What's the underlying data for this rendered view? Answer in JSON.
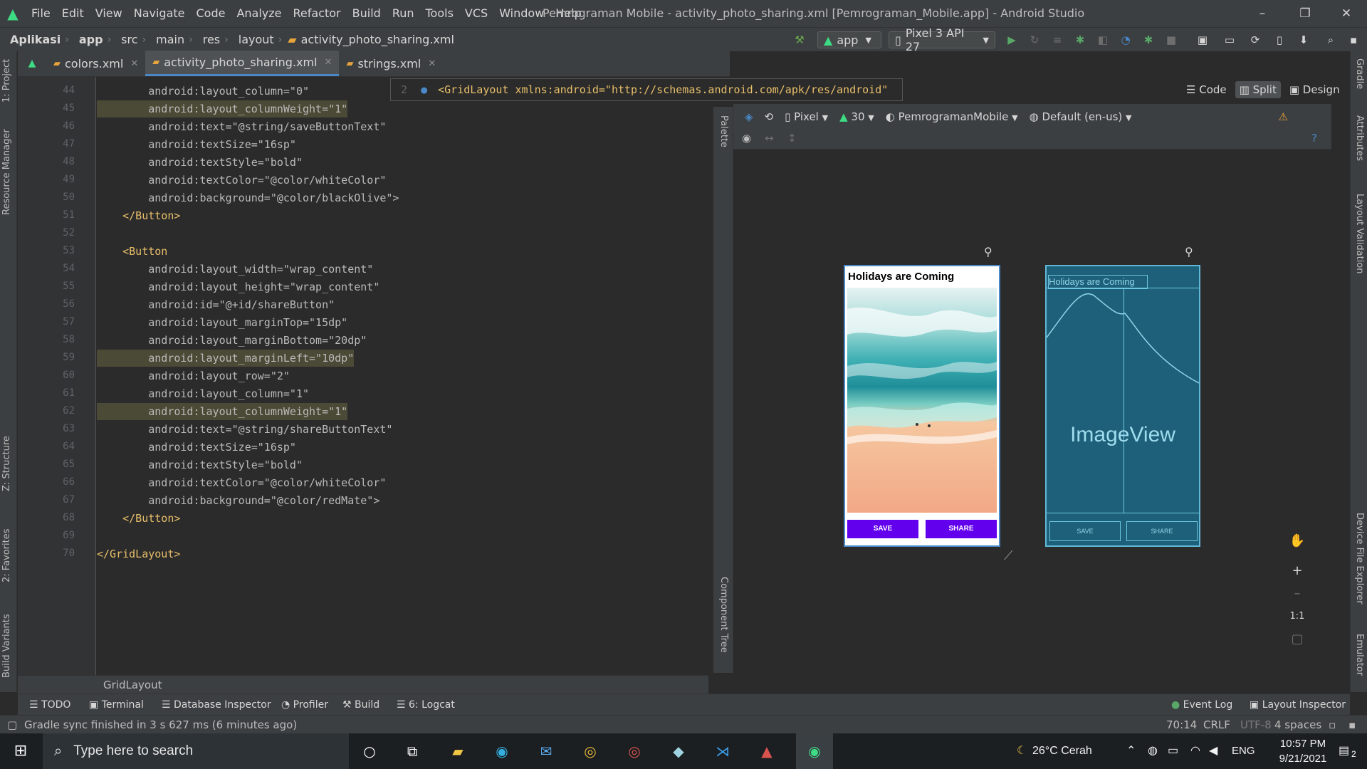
{
  "window": {
    "title": "Pemrograman Mobile - activity_photo_sharing.xml [Pemrograman_Mobile.app] - Android Studio",
    "controls": {
      "minimize": "–",
      "maximize": "❐",
      "close": "✕"
    }
  },
  "menu": [
    "File",
    "Edit",
    "View",
    "Navigate",
    "Code",
    "Analyze",
    "Refactor",
    "Build",
    "Run",
    "Tools",
    "VCS",
    "Window",
    "Help"
  ],
  "breadcrumb": [
    "Aplikasi",
    "app",
    "src",
    "main",
    "res",
    "layout",
    "activity_photo_sharing.xml"
  ],
  "toolbar": {
    "run_config": "app",
    "device": "Pixel 3 API 27"
  },
  "tabs": [
    {
      "label": "colors.xml"
    },
    {
      "label": "activity_photo_sharing.xml"
    },
    {
      "label": "strings.xml"
    }
  ],
  "left_strip": {
    "project": "1: Project",
    "resource_manager": "Resource Manager",
    "structure": "Z: Structure",
    "favorites": "2: Favorites",
    "build_variants": "Build Variants"
  },
  "right_strip": {
    "gradle": "Gradle",
    "attributes": "Attributes",
    "layout_validation": "Layout Validation",
    "device_file_explorer": "Device File Explorer",
    "emulator": "Emulator"
  },
  "breadcrumb_popup": {
    "line": "2",
    "code": "<GridLayout xmlns:android=\"http://schemas.android.com/apk/res/android\""
  },
  "editor": {
    "lines": [
      {
        "n": "44",
        "text": "        android:layout_column=\"0\""
      },
      {
        "n": "45",
        "text": "        android:layout_columnWeight=\"1\""
      },
      {
        "n": "46",
        "text": "        android:text=\"@string/saveButtonText\""
      },
      {
        "n": "47",
        "text": "        android:textSize=\"16sp\""
      },
      {
        "n": "48",
        "text": "        android:textStyle=\"bold\""
      },
      {
        "n": "49",
        "text": "        android:textColor=\"@color/whiteColor\""
      },
      {
        "n": "50",
        "text": "        android:background=\"@color/blackOlive\">"
      },
      {
        "n": "51",
        "text": "    </Button>"
      },
      {
        "n": "52",
        "text": ""
      },
      {
        "n": "53",
        "text": "    <Button"
      },
      {
        "n": "54",
        "text": "        android:layout_width=\"wrap_content\""
      },
      {
        "n": "55",
        "text": "        android:layout_height=\"wrap_content\""
      },
      {
        "n": "56",
        "text": "        android:id=\"@+id/shareButton\""
      },
      {
        "n": "57",
        "text": "        android:layout_marginTop=\"15dp\""
      },
      {
        "n": "58",
        "text": "        android:layout_marginBottom=\"20dp\""
      },
      {
        "n": "59",
        "text": "        android:layout_marginLeft=\"10dp\""
      },
      {
        "n": "60",
        "text": "        android:layout_row=\"2\""
      },
      {
        "n": "61",
        "text": "        android:layout_column=\"1\""
      },
      {
        "n": "62",
        "text": "        android:layout_columnWeight=\"1\""
      },
      {
        "n": "63",
        "text": "        android:text=\"@string/shareButtonText\""
      },
      {
        "n": "64",
        "text": "        android:textSize=\"16sp\""
      },
      {
        "n": "65",
        "text": "        android:textStyle=\"bold\""
      },
      {
        "n": "66",
        "text": "        android:textColor=\"@color/whiteColor\""
      },
      {
        "n": "67",
        "text": "        android:background=\"@color/redMate\">"
      },
      {
        "n": "68",
        "text": "    </Button>"
      },
      {
        "n": "69",
        "text": ""
      },
      {
        "n": "70",
        "text": "</GridLayout>"
      }
    ],
    "footer_breadcrumb": "GridLayout"
  },
  "view_modes": {
    "code": "Code",
    "split": "Split",
    "design": "Design"
  },
  "design_toolbar": {
    "device": "Pixel",
    "api": "30",
    "theme": "PemrogramanMobile",
    "locale": "Default (en-us)"
  },
  "palette": {
    "palette": "Palette",
    "component_tree": "Component Tree"
  },
  "preview": {
    "title": "Holidays are Coming",
    "save_button": "SAVE",
    "share_button": "SHARE",
    "blueprint_title": "Holidays are Coming",
    "blueprint_image": "ImageView",
    "blueprint_save": "SAVE",
    "blueprint_share": "SHARE"
  },
  "zoom": {
    "zoom_in": "+",
    "zoom_out": "–",
    "actual_size": "1:1"
  },
  "tool_windows": {
    "todo": "TODO",
    "terminal": "Terminal",
    "database_inspector": "Database Inspector",
    "profiler": "Profiler",
    "build": "Build",
    "logcat": "6: Logcat",
    "event_log": "Event Log",
    "layout_inspector": "Layout Inspector"
  },
  "status": {
    "message": "Gradle sync finished in 3 s 627 ms (6 minutes ago)",
    "position": "70:14",
    "line_sep": "CRLF",
    "encoding": "UTF-8",
    "indent": "4 spaces"
  },
  "taskbar": {
    "search_placeholder": "Type here to search",
    "weather": "26°C  Cerah",
    "language": "ENG",
    "time": "10:57 PM",
    "date": "9/21/2021",
    "notifications": "2"
  },
  "colors": {
    "accent": "#4a88c7",
    "purple_button": "#6200ee",
    "blueprint": "#1e6079",
    "android_green": "#3ddc84"
  }
}
